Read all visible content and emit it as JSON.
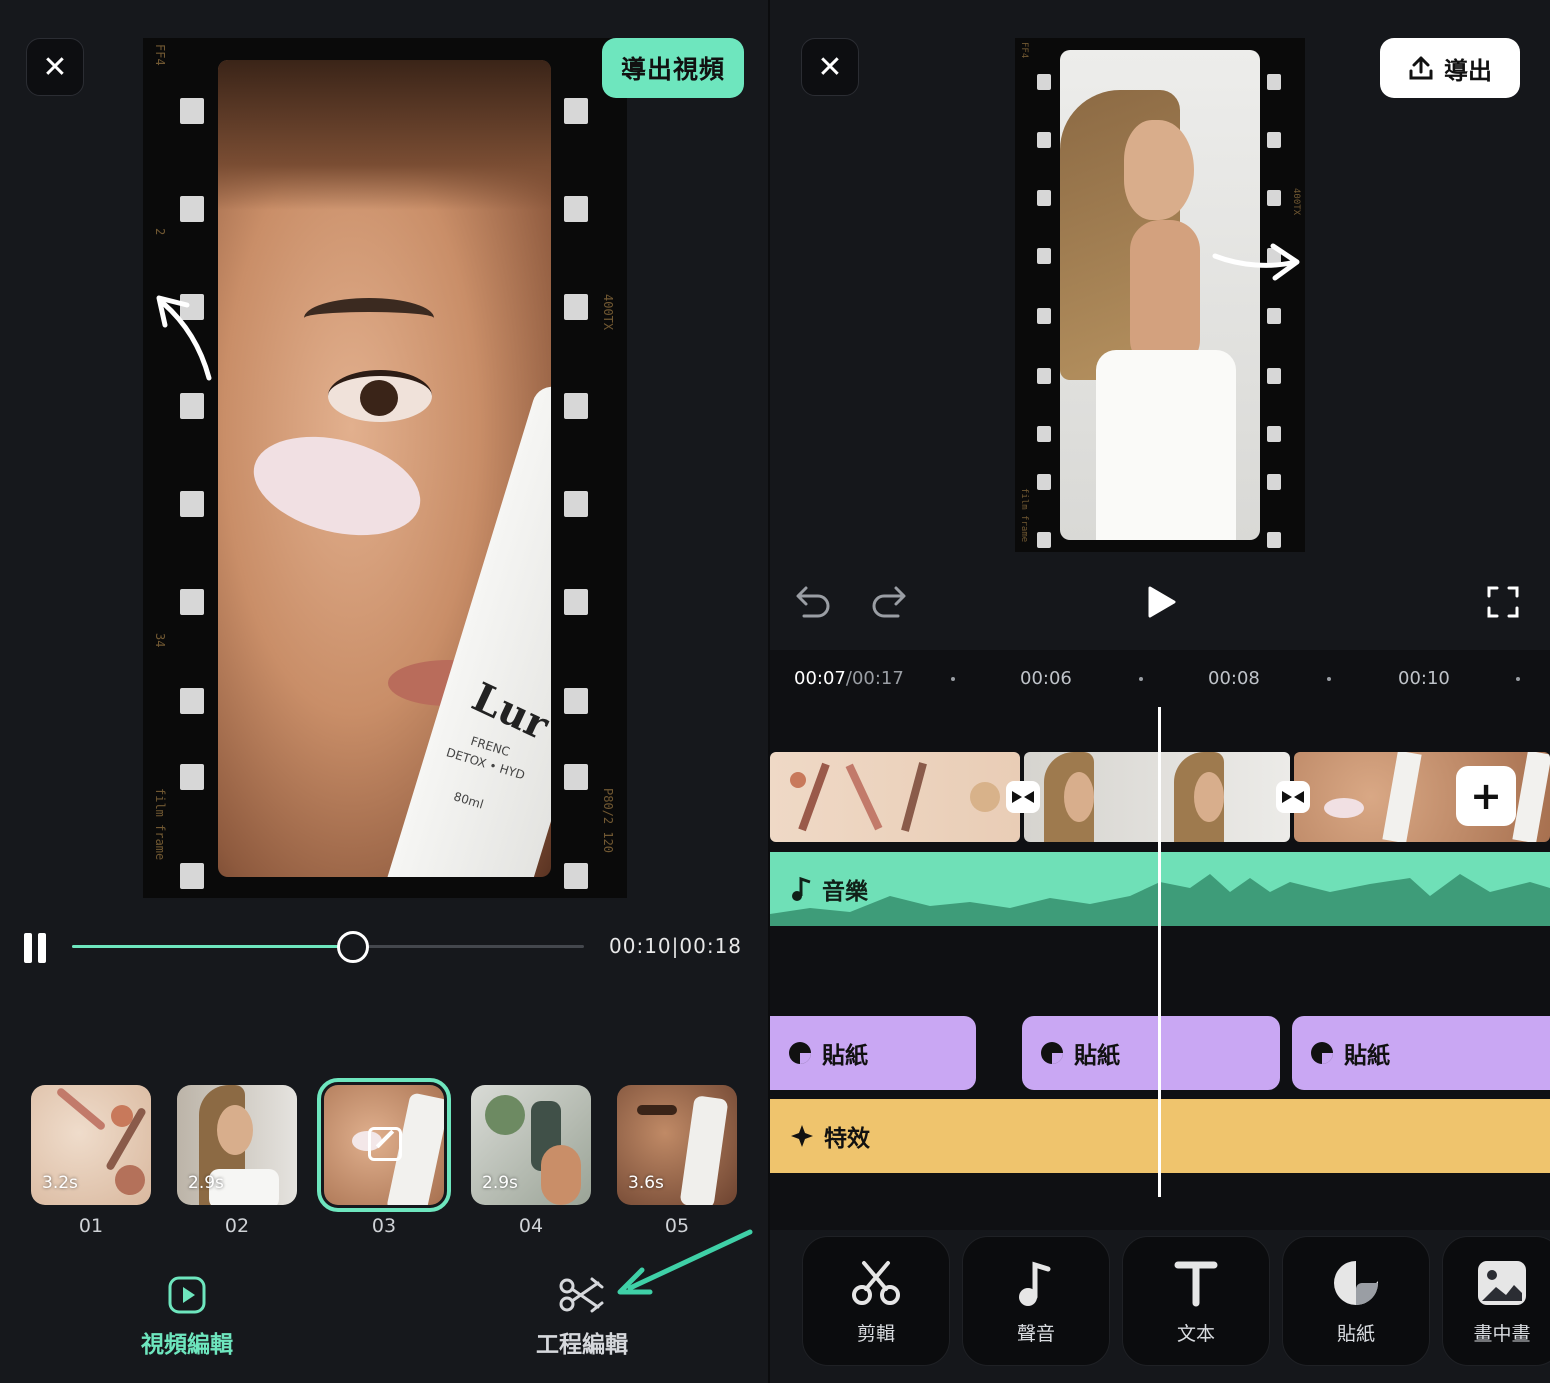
{
  "left": {
    "close_symbol": "✕",
    "export_button": "導出視頻",
    "film_labels": {
      "top": "FF4",
      "mid": "2",
      "low": "34",
      "brand": "film frame",
      "right": "400TX",
      "right_low": "P80/2 120"
    },
    "product_text": {
      "brand": "Lur",
      "line1": "FRENC",
      "line2": "DETOX • HYD",
      "line3": "80ml"
    },
    "player": {
      "time": "00:10|00:18",
      "progress": 0.546
    },
    "clips": [
      {
        "duration": "3.2s",
        "number": "01"
      },
      {
        "duration": "2.9s",
        "number": "02"
      },
      {
        "duration": "",
        "number": "03",
        "selected": true
      },
      {
        "duration": "2.9s",
        "number": "04"
      },
      {
        "duration": "3.6s",
        "number": "05"
      }
    ],
    "tabs": [
      {
        "label": "視頻編輯",
        "icon": "play-square-icon",
        "active": true,
        "color": "#6ee6be"
      },
      {
        "label": "工程編輯",
        "icon": "scissors-icon",
        "active": false,
        "color": "#d6d8dc"
      }
    ],
    "arrow_color": "#3fd0a7"
  },
  "right": {
    "close_symbol": "✕",
    "export_button": "導出",
    "timeline": {
      "current": "00:07",
      "total": "/00:17",
      "ticks": [
        "00:06",
        "00:08",
        "00:10"
      ]
    },
    "tracks": {
      "music": "音樂",
      "stickers": [
        "貼紙",
        "貼紙",
        "貼紙"
      ],
      "effect": "特效"
    },
    "tools": [
      "剪輯",
      "聲音",
      "文本",
      "貼紙",
      "畫中畫"
    ],
    "colors": {
      "accent": "#6ee6be",
      "sticker": "#c9a7f3",
      "effect": "#efc46d",
      "music": "#6fe0b7"
    }
  }
}
